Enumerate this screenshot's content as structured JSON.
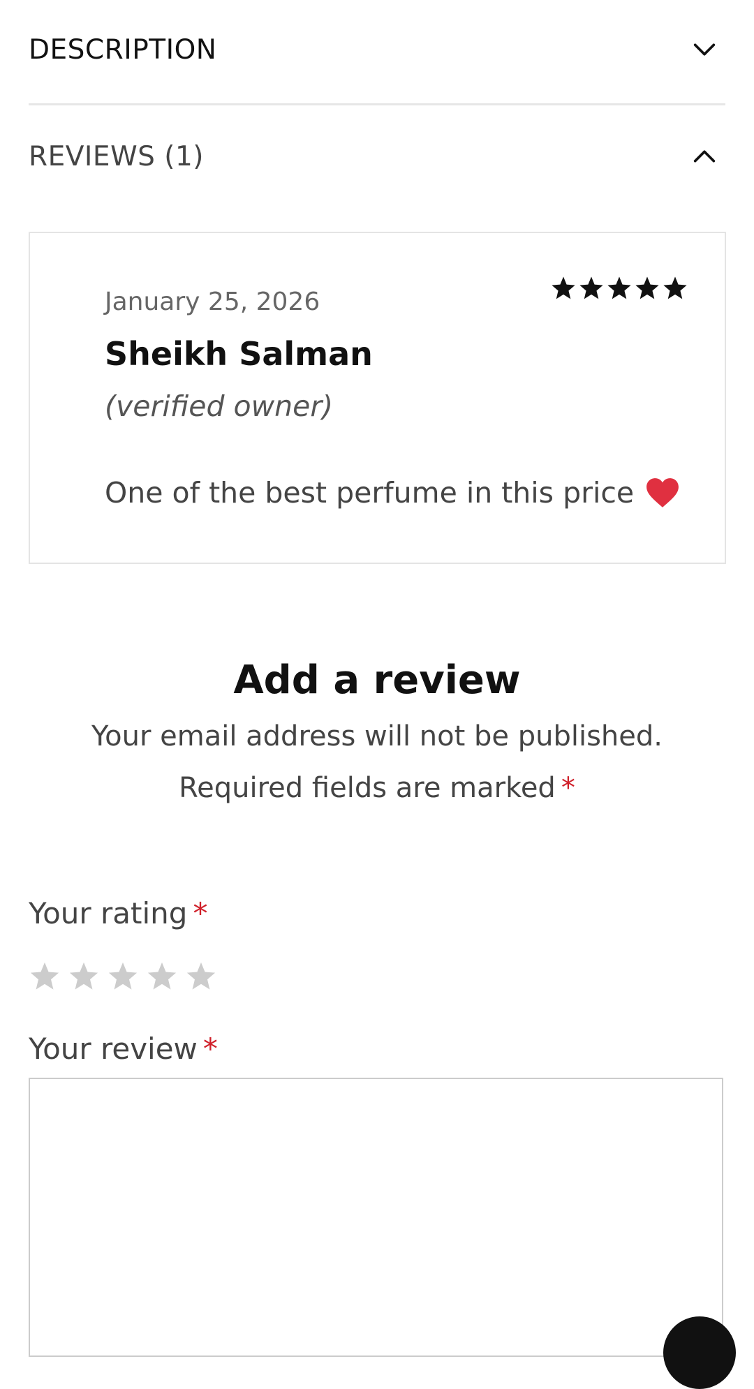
{
  "description_section": {
    "title": "DESCRIPTION"
  },
  "reviews_section": {
    "title": "REVIEWS (1)",
    "review": {
      "date": "January 25, 2026",
      "rating": 5,
      "author": "Sheikh Salman",
      "verified": "(verified owner)",
      "text": "One of the best perfume in this price"
    }
  },
  "add_review": {
    "title": "Add a review",
    "notice_line1": "Your email address will not be published.",
    "notice_line2": "Required fields are marked",
    "required_mark": "*",
    "rating_label": "Your rating",
    "review_label": "Your review",
    "review_value": ""
  },
  "colors": {
    "required": "#d0202a",
    "heart": "#e03040",
    "star_filled": "#111111",
    "star_empty": "#cccccc"
  }
}
